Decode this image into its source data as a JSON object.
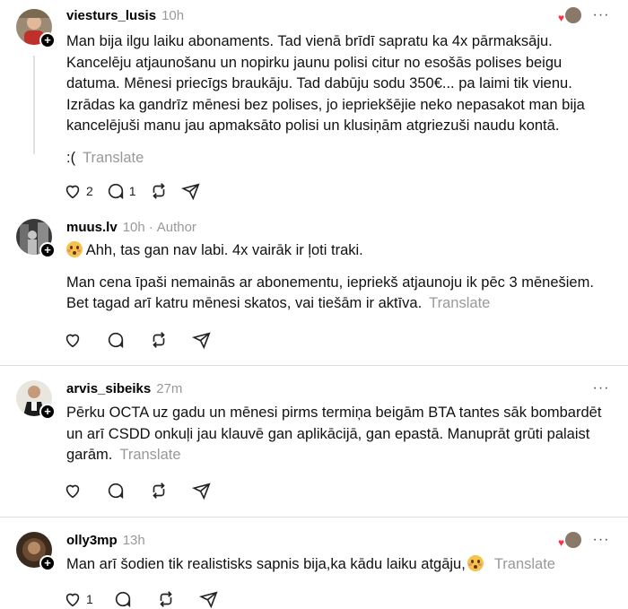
{
  "posts": [
    {
      "username": "viesturs_lusis",
      "time": "10h",
      "liked_by_author": true,
      "paragraphs": [
        "Man bija ilgu laiku abonaments. Tad vienā brīdī sapratu ka 4x pārmaksāju. Kancelēju atjaunošanu un nopirku jaunu polisi citur no esošās polises beigu datuma. Mēnesi priecīgs braukāju. Tad dabūju sodu 350€... pa laimi tik vienu. Izrādas ka gandrīz mēnesi bez polises, jo iepriekšējie neko nepasakot man bija kancelējuši manu jau apmaksāto polisi un klusiņām atgriezuši naudu kontā.",
        ":("
      ],
      "translate": "Translate",
      "likes": "2",
      "replies": "1"
    },
    {
      "username": "muus.lv",
      "time": "10h",
      "author_label": "Author",
      "paragraphs": [
        "Ahh, tas gan nav labi. 4x vairāk ir ļoti traki.",
        "Man cena īpaši nemainās ar abonementu, iepriekš atjaunoju ik pēc 3 mēnešiem. Bet tagad arī katru mēnesi skatos, vai tiešām ir aktīva."
      ],
      "translate": "Translate"
    },
    {
      "username": "arvis_sibeiks",
      "time": "27m",
      "paragraphs": [
        "Pērku OCTA uz gadu un mēnesi pirms termiņa beigām BTA tantes sāk bombardēt un arī CSDD onkuļi jau klauvē gan aplikācijā, gan epastā. Manuprāt grūti palaist garām."
      ],
      "translate": "Translate"
    },
    {
      "username": "olly3mp",
      "time": "13h",
      "liked_by_author": true,
      "paragraphs": [
        "Man arī šodien tik realistisks sapnis bija,ka kādu laiku atgāju,"
      ],
      "translate": "Translate",
      "likes": "1"
    }
  ],
  "icons": {
    "like": "heart-icon",
    "reply": "comment-icon",
    "repost": "repost-icon",
    "share": "send-icon",
    "more": "more-icon",
    "follow": "plus-icon"
  },
  "colors": {
    "muted": "#999999",
    "heart": "#ff3040",
    "divider": "#dddddd"
  }
}
